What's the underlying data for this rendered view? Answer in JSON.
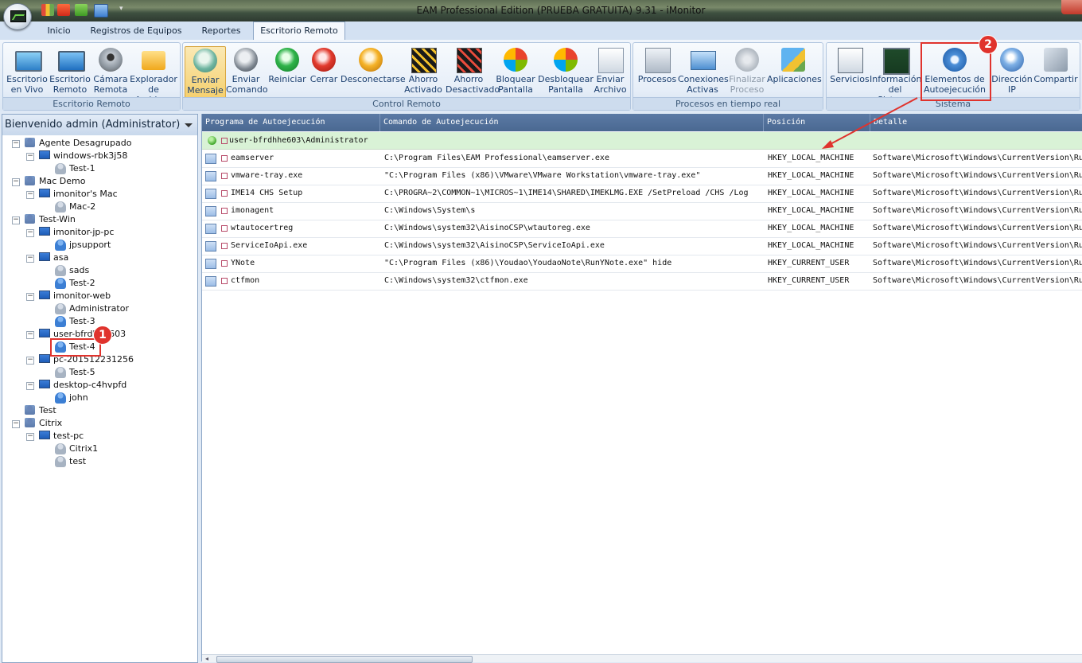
{
  "window": {
    "title": "EAM Professional Edition (PRUEBA GRATUITA) 9.31 - iMonitor"
  },
  "tabs": [
    {
      "label": "Inicio"
    },
    {
      "label": "Registros de Equipos"
    },
    {
      "label": "Reportes"
    },
    {
      "label": "Escritorio Remoto"
    }
  ],
  "active_tab": "Escritorio Remoto",
  "ribbon": {
    "groups": [
      {
        "label": "Escritorio Remoto"
      },
      {
        "label": "Control Remoto"
      },
      {
        "label": "Procesos en tiempo real"
      },
      {
        "label": "Sistema"
      }
    ],
    "buttons": [
      {
        "label": "Escritorio\nen Vivo"
      },
      {
        "label": "Escritorio\nRemoto"
      },
      {
        "label": "Cámara\nRemota"
      },
      {
        "label": "Explorador\nde Archivos"
      },
      {
        "label": "Enviar\nMensaje"
      },
      {
        "label": "Enviar\nComando"
      },
      {
        "label": "Reiniciar"
      },
      {
        "label": "Cerrar"
      },
      {
        "label": "Desconectarse"
      },
      {
        "label": "Ahorro\nActivado"
      },
      {
        "label": "Ahorro\nDesactivado"
      },
      {
        "label": "Bloquear\nPantalla"
      },
      {
        "label": "Desbloquear\nPantalla"
      },
      {
        "label": "Enviar\nArchivo"
      },
      {
        "label": "Procesos"
      },
      {
        "label": "Conexiones\nActivas"
      },
      {
        "label": "Finalizar\nProceso"
      },
      {
        "label": "Aplicaciones"
      },
      {
        "label": "Servicios"
      },
      {
        "label": "Información\ndel Sistema"
      },
      {
        "label": "Elementos de\nAutoejecución"
      },
      {
        "label": "Dirección\nIP"
      },
      {
        "label": "Compartir"
      }
    ]
  },
  "annotations": {
    "badge1": "1",
    "badge2": "2"
  },
  "left_panel": {
    "header": "Bienvenido admin (Administrator)",
    "tree": [
      {
        "label": "Agente Desagrupado"
      },
      {
        "label": "windows-rbk3j58"
      },
      {
        "label": "Test-1"
      },
      {
        "label": "Mac Demo"
      },
      {
        "label": "imonitor's Mac"
      },
      {
        "label": "Mac-2"
      },
      {
        "label": "Test-Win"
      },
      {
        "label": "imonitor-jp-pc"
      },
      {
        "label": "jpsupport"
      },
      {
        "label": "asa"
      },
      {
        "label": "sads"
      },
      {
        "label": "Test-2"
      },
      {
        "label": "imonitor-web"
      },
      {
        "label": "Administrator"
      },
      {
        "label": "Test-3"
      },
      {
        "label": "user-bfrdhhe603"
      },
      {
        "label": "Test-4"
      },
      {
        "label": "pc-201512231256"
      },
      {
        "label": "Test-5"
      },
      {
        "label": "desktop-c4hvpfd"
      },
      {
        "label": "john"
      },
      {
        "label": "Test"
      },
      {
        "label": "Citrix"
      },
      {
        "label": "test-pc"
      },
      {
        "label": "Citrix1"
      },
      {
        "label": "test"
      }
    ]
  },
  "grid": {
    "columns": [
      "Programa de Autoejecución",
      "Comando de Autoejecución",
      "Posición",
      "Detalle"
    ],
    "group_label": "user-bfrdhhe603\\Administrator",
    "rows": [
      {
        "program": "eamserver",
        "command": "C:\\Program Files\\EAM Professional\\eamserver.exe",
        "position": "HKEY_LOCAL_MACHINE",
        "detail": "Software\\Microsoft\\Windows\\CurrentVersion\\Ru"
      },
      {
        "program": "vmware-tray.exe",
        "command": "\"C:\\Program Files (x86)\\VMware\\VMware Workstation\\vmware-tray.exe\"",
        "position": "HKEY_LOCAL_MACHINE",
        "detail": "Software\\Microsoft\\Windows\\CurrentVersion\\Ru"
      },
      {
        "program": "IME14 CHS Setup",
        "command": "C:\\PROGRA~2\\COMMON~1\\MICROS~1\\IME14\\SHARED\\IMEKLMG.EXE /SetPreload /CHS /Log",
        "position": "HKEY_LOCAL_MACHINE",
        "detail": "Software\\Microsoft\\Windows\\CurrentVersion\\Ru"
      },
      {
        "program": "imonagent",
        "command": "C:\\Windows\\System\\s",
        "position": "HKEY_LOCAL_MACHINE",
        "detail": "Software\\Microsoft\\Windows\\CurrentVersion\\Ru"
      },
      {
        "program": "wtautocertreg",
        "command": "C:\\Windows\\system32\\AisinoCSP\\wtautoreg.exe",
        "position": "HKEY_LOCAL_MACHINE",
        "detail": "Software\\Microsoft\\Windows\\CurrentVersion\\Ru"
      },
      {
        "program": "ServiceIoApi.exe",
        "command": "C:\\Windows\\system32\\AisinoCSP\\ServiceIoApi.exe",
        "position": "HKEY_LOCAL_MACHINE",
        "detail": "Software\\Microsoft\\Windows\\CurrentVersion\\Ru"
      },
      {
        "program": "YNote",
        "command": "\"C:\\Program Files (x86)\\Youdao\\YoudaoNote\\RunYNote.exe\" hide",
        "position": "HKEY_CURRENT_USER",
        "detail": "Software\\Microsoft\\Windows\\CurrentVersion\\Ru"
      },
      {
        "program": "ctfmon",
        "command": "C:\\Windows\\system32\\ctfmon.exe",
        "position": "HKEY_CURRENT_USER",
        "detail": "Software\\Microsoft\\Windows\\CurrentVersion\\Ru"
      }
    ]
  },
  "colors": {
    "accent_red": "#e0332d",
    "grid_header": "#4a6891",
    "group_row": "#d9f2d6",
    "selected_button": "#f5cf6c"
  }
}
